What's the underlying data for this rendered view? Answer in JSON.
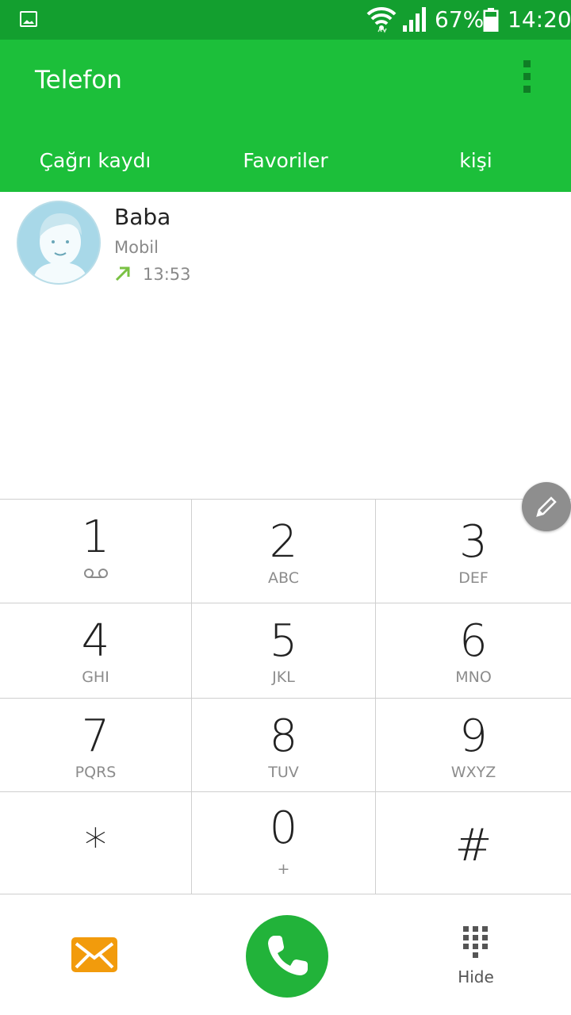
{
  "status_bar": {
    "battery_percent": "67%",
    "time": "14:20"
  },
  "app_bar": {
    "title": "Telefon"
  },
  "tabs": [
    {
      "label": "Çağrı kaydı"
    },
    {
      "label": "Favoriler"
    },
    {
      "label": "kişi"
    }
  ],
  "call_log": [
    {
      "name": "Baba",
      "type": "Mobil",
      "time": "13:53"
    }
  ],
  "keypad": [
    {
      "digit": "1",
      "letters": ""
    },
    {
      "digit": "2",
      "letters": "ABC"
    },
    {
      "digit": "3",
      "letters": "DEF"
    },
    {
      "digit": "4",
      "letters": "GHI"
    },
    {
      "digit": "5",
      "letters": "JKL"
    },
    {
      "digit": "6",
      "letters": "MNO"
    },
    {
      "digit": "7",
      "letters": "PQRS"
    },
    {
      "digit": "8",
      "letters": "TUV"
    },
    {
      "digit": "9",
      "letters": "WXYZ"
    },
    {
      "digit": "*",
      "letters": ""
    },
    {
      "digit": "0",
      "letters": "+"
    },
    {
      "digit": "#",
      "letters": ""
    }
  ],
  "bottom_bar": {
    "hide_label": "Hide"
  },
  "colors": {
    "status_bar": "#139f2f",
    "app_bar": "#1cbf3a",
    "call_button": "#22b33a",
    "message_button": "#f29b0c",
    "outgoing_arrow": "#7ac143"
  },
  "icons": {
    "status": [
      "gallery-icon",
      "wifi-icon",
      "signal-icon",
      "battery-icon"
    ],
    "menu": "more-vert-icon",
    "fab": "pencil-icon",
    "bottom": [
      "message-icon",
      "phone-icon",
      "dialpad-icon"
    ]
  }
}
